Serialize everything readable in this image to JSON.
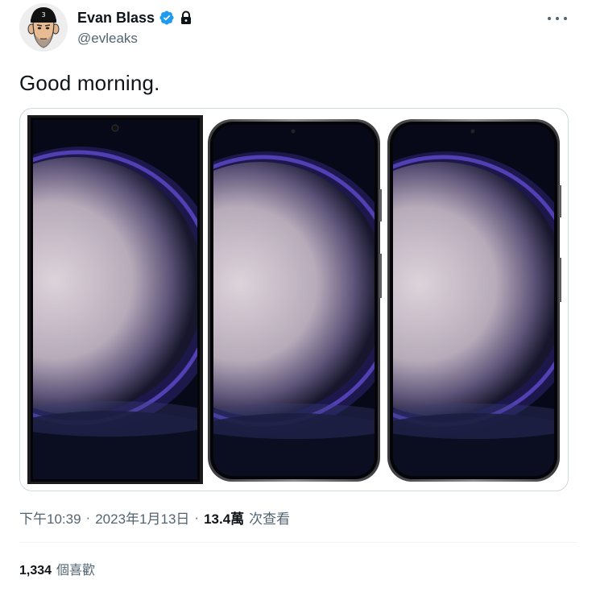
{
  "author": {
    "name": "Evan Blass",
    "handle": "@evleaks",
    "verified": true,
    "protected": true
  },
  "tweet": {
    "text": "Good morning.",
    "time": "下午10:39",
    "date": "2023年1月13日",
    "separator": "·",
    "views_count": "13.4萬",
    "views_label": "次查看"
  },
  "stats": {
    "likes_count": "1,334",
    "likes_label": "個喜歡"
  },
  "media": {
    "images": [
      {
        "icon": "phone-ultra-image"
      },
      {
        "icon": "phone-plus-image"
      },
      {
        "icon": "phone-base-image"
      }
    ]
  },
  "colors": {
    "text": "#0f1419",
    "secondary": "#536471",
    "verified": "#1d9bf0",
    "border": "#cfd9de",
    "wallpaper_dark": "#0a0b1a",
    "wallpaper_glow": "#d9cfd8",
    "wallpaper_ring": "#5a47c6"
  }
}
